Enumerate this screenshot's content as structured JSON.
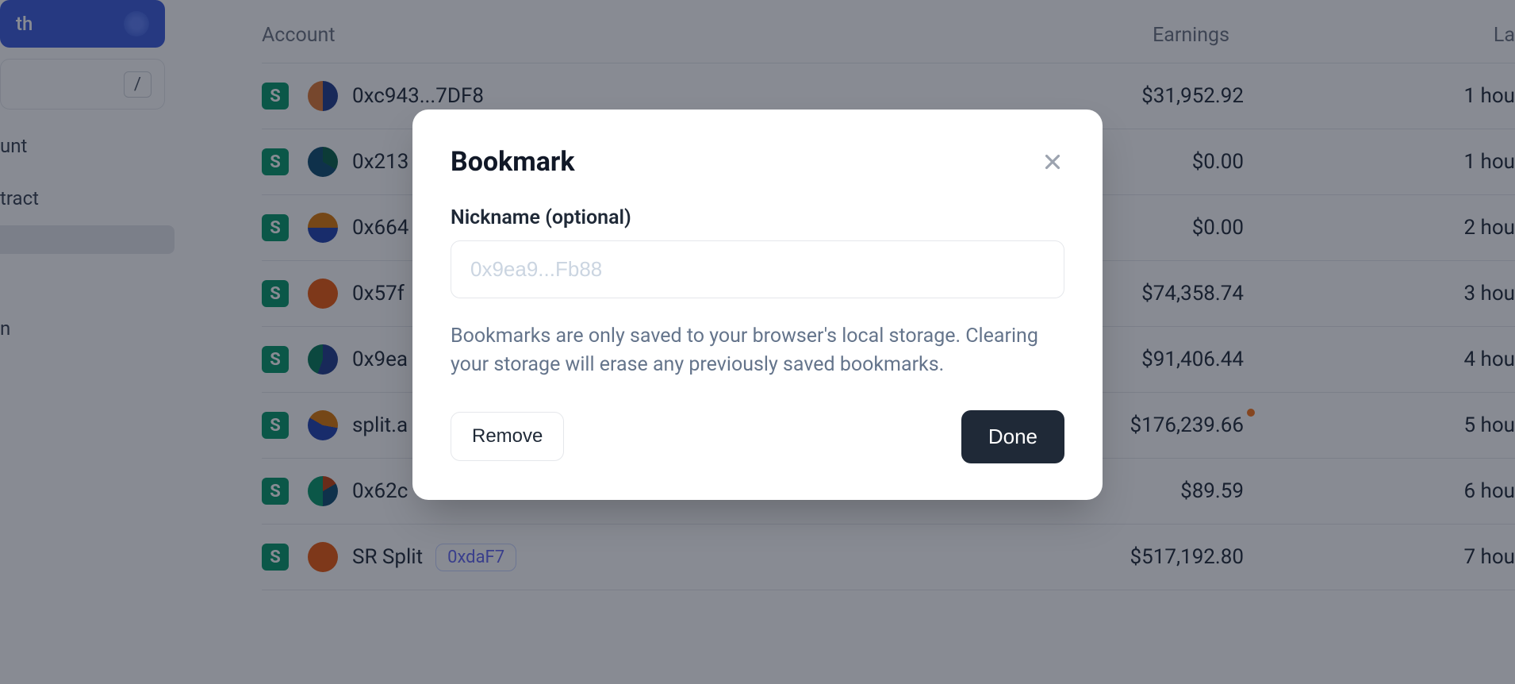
{
  "sidebar": {
    "network_suffix": "th",
    "search_kbd": "/",
    "nav": {
      "item0": "unt",
      "item1": "tract",
      "item2": "",
      "item3": "n"
    }
  },
  "table": {
    "headers": {
      "account": "Account",
      "earnings": "Earnings",
      "last": "La"
    },
    "badge_letter": "S",
    "rows": [
      {
        "label": "0xc943...7DF8",
        "earnings": "$31,952.92",
        "last": "1 hou"
      },
      {
        "label": "0x213",
        "earnings": "$0.00",
        "last": "1 hou"
      },
      {
        "label": "0x664",
        "earnings": "$0.00",
        "last": "2 hou"
      },
      {
        "label": "0x57f",
        "earnings": "$74,358.74",
        "last": "3 hou"
      },
      {
        "label": "0x9ea",
        "earnings": "$91,406.44",
        "last": "4 hou"
      },
      {
        "label": "split.a",
        "earnings": "$176,239.66",
        "last": "5 hou",
        "dot": true
      },
      {
        "label": "0x62c",
        "earnings": "$89.59",
        "last": "6 hou"
      },
      {
        "label": "SR Split",
        "chip": "0xdaF7",
        "earnings": "$517,192.80",
        "last": "7 hou"
      }
    ]
  },
  "modal": {
    "title": "Bookmark",
    "field_label": "Nickname (optional)",
    "placeholder": "0x9ea9...Fb88",
    "helper": "Bookmarks are only saved to your browser's local storage. Clearing your storage will erase any previously saved bookmarks.",
    "remove": "Remove",
    "done": "Done"
  }
}
